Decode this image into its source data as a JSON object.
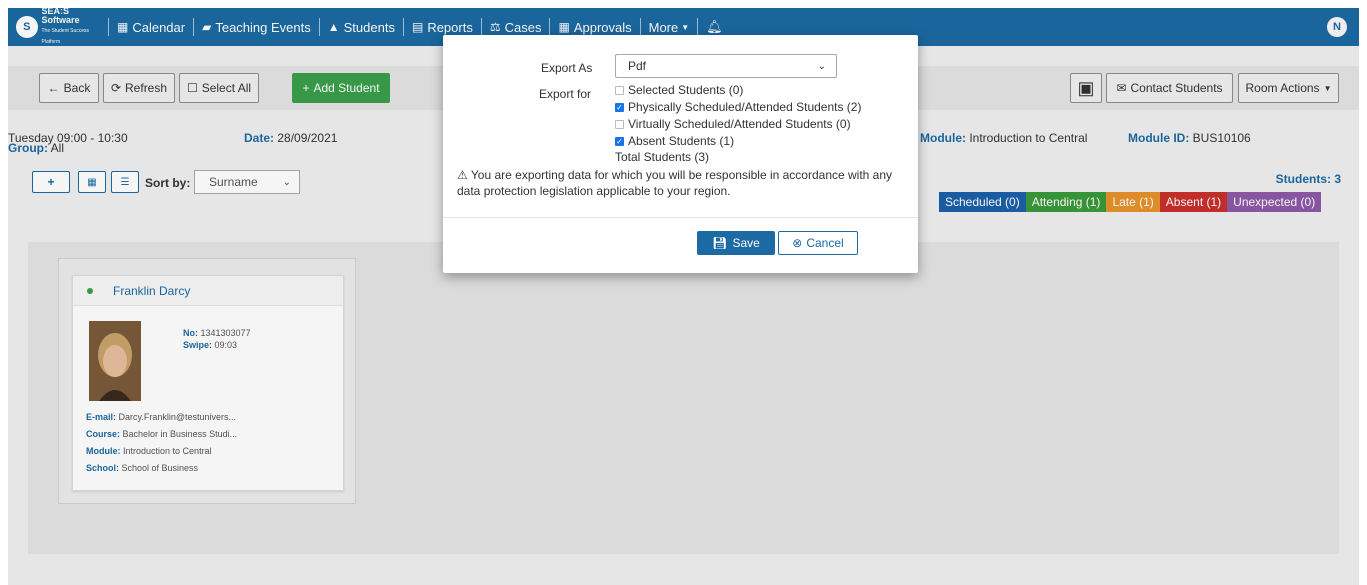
{
  "nav": {
    "brand_name": "SEA:S Software",
    "brand_tagline": "The Student Success Platform",
    "logo_glyph": "S",
    "items": [
      {
        "label": "Calendar",
        "icon": "calendar-icon"
      },
      {
        "label": "Teaching Events",
        "icon": "book-icon"
      },
      {
        "label": "Students",
        "icon": "graduation-cap-icon"
      },
      {
        "label": "Reports",
        "icon": "document-icon"
      },
      {
        "label": "Cases",
        "icon": "cases-icon"
      },
      {
        "label": "Approvals",
        "icon": "calendar-check-icon"
      },
      {
        "label": "More",
        "icon": "caret-down-icon"
      }
    ],
    "avatar_initial": "N"
  },
  "toolbar": {
    "back_label": "Back",
    "refresh_label": "Refresh",
    "select_all_label": "Select All",
    "add_student_label": "Add Student",
    "contact_label": "Contact Students",
    "room_actions_label": "Room Actions"
  },
  "event": {
    "time": "Tuesday 09:00 - 10:30",
    "group_label": "Group:",
    "group_value": "All",
    "date_label": "Date:",
    "date_value": "28/09/2021",
    "module_label": "Module:",
    "module_value": "Introduction to Central",
    "module_id_label": "Module ID:",
    "module_id_value": "BUS10106",
    "students_count": "Students: 3"
  },
  "sort": {
    "label": "Sort by:",
    "value": "Surname"
  },
  "legend": [
    {
      "label": "Scheduled (0)",
      "color": "#1c5fa8"
    },
    {
      "label": "Attending (1)",
      "color": "#3a9a3a"
    },
    {
      "label": "Late (1)",
      "color": "#e8912c"
    },
    {
      "label": "Absent (1)",
      "color": "#c9302c"
    },
    {
      "label": "Unexpected (0)",
      "color": "#8e5aa8"
    }
  ],
  "student": {
    "name": "Franklin Darcy",
    "no_label": "No:",
    "no_value": "1341303077",
    "swipe_label": "Swipe:",
    "swipe_value": "09:03",
    "email_label": "E-mail:",
    "email_value": "Darcy.Franklin@testunivers...",
    "course_label": "Course:",
    "course_value": "Bachelor in Business Studi...",
    "module_label": "Module:",
    "module_value": "Introduction to Central",
    "school_label": "School:",
    "school_value": "School of Business"
  },
  "modal": {
    "export_as_label": "Export As",
    "export_as_value": "Pdf",
    "export_for_label": "Export for",
    "options": [
      {
        "label": "Selected Students (0)",
        "checked": false
      },
      {
        "label": "Physically Scheduled/Attended Students (2)",
        "checked": true
      },
      {
        "label": "Virtually Scheduled/Attended Students (0)",
        "checked": false
      },
      {
        "label": "Absent Students (1)",
        "checked": true
      }
    ],
    "total": "Total Students (3)",
    "warning": "You are exporting data for which you will be responsible in accordance with any data protection legislation applicable to your region.",
    "save_label": "Save",
    "cancel_label": "Cancel"
  }
}
